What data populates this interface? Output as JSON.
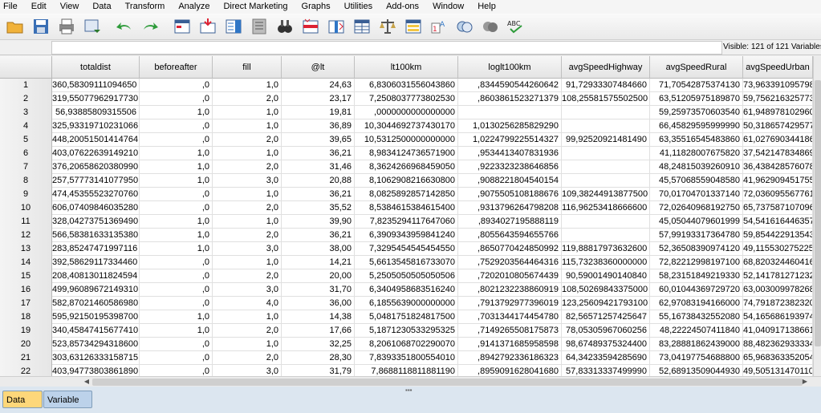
{
  "menu": [
    "File",
    "Edit",
    "View",
    "Data",
    "Transform",
    "Analyze",
    "Direct Marketing",
    "Graphs",
    "Utilities",
    "Add-ons",
    "Window",
    "Help"
  ],
  "toolbar": {
    "icons": [
      "open-folder-icon",
      "save-icon",
      "print-icon",
      "recall-dialog-icon",
      "undo-icon",
      "redo-icon",
      "goto-case-icon",
      "goto-variable-icon",
      "variables-icon",
      "run-descriptives-icon",
      "find-icon",
      "insert-cases-icon",
      "insert-variable-icon",
      "split-file-icon",
      "weight-cases-icon",
      "select-cases-icon",
      "value-labels-icon",
      "use-variable-sets-icon",
      "show-all-variables-icon",
      "spelling-icon"
    ]
  },
  "status": {
    "visible": "Visible: 121 of 121 Variables"
  },
  "grid": {
    "columns": [
      "totaldist",
      "beforeafter",
      "fill",
      "@lt",
      "lt100km",
      "loglt100km",
      "avgSpeedHighway",
      "avgSpeedRural",
      "avgSpeedUrban"
    ],
    "rows": [
      [
        "1",
        "360,58309111094650",
        ",0",
        "1,0",
        "24,63",
        "6,8306031556043860",
        ",8344590544260642",
        "91,72933307484660",
        "71,70542875374130",
        "73,963391095798"
      ],
      [
        "2",
        "319,55077962917730",
        ",0",
        "2,0",
        "23,17",
        "7,2508037773802530",
        ",8603861523271379",
        "108,25581575502500",
        "63,51205975189870",
        "59,756216325773"
      ],
      [
        "3",
        "56,93885809315506",
        "1,0",
        "1,0",
        "19,81",
        ",0000000000000000",
        "",
        "",
        "59,25973570603540",
        "61,948978102960"
      ],
      [
        "4",
        "325,93319710231066",
        ",0",
        "1,0",
        "36,89",
        "10,3044692737430170",
        "1,0130256285829290",
        "",
        "66,45829595999990",
        "50,318657429577"
      ],
      [
        "5",
        "448,20051501414764",
        ",0",
        "2,0",
        "39,65",
        "10,5312500000000000",
        "1,0224799225514327",
        "99,92520921481490",
        "63,35516545483860",
        "61,027690344186"
      ],
      [
        "6",
        "403,07622639149210",
        "1,0",
        "1,0",
        "36,21",
        "8,9834124736571900",
        ",9534413407831936",
        "",
        "41,11828007675820",
        "37,542147834869"
      ],
      [
        "7",
        "376,20658620380990",
        "1,0",
        "2,0",
        "31,46",
        "8,3624266968459050",
        ",9223323238646856",
        "",
        "48,24815039260910",
        "36,438428576078"
      ],
      [
        "8",
        "257,57773141077950",
        "1,0",
        "3,0",
        "20,88",
        "8,1062908216630800",
        ",9088221804540154",
        "",
        "45,57068559048580",
        "41,962909451755"
      ],
      [
        "9",
        "474,45355523270760",
        ",0",
        "1,0",
        "36,21",
        "8,0825892857142850",
        ",9075505108188676",
        "109,38244913877500",
        "70,01704701337140",
        "72,036095567761"
      ],
      [
        "10",
        "606,07409846035280",
        ",0",
        "2,0",
        "35,52",
        "8,5384615384615400",
        ",9313796264798208",
        "116,96253418666600",
        "72,02640968192750",
        "65,737587107096"
      ],
      [
        "11",
        "328,04273751369490",
        "1,0",
        "1,0",
        "39,90",
        "7,8235294117647060",
        ",8934027195888119",
        "",
        "45,05044079601999",
        "54,541616446357"
      ],
      [
        "12",
        "566,58381633135380",
        "1,0",
        "2,0",
        "36,21",
        "6,3909343959841240",
        ",8055643594655766",
        "",
        "57,99193317364780",
        "59,854422913543"
      ],
      [
        "13",
        "283,85247471997116",
        "1,0",
        "3,0",
        "38,00",
        "7,3295454545454550",
        ",8650770424850992",
        "119,88817973632600",
        "52,36508390974120",
        "49,115530275225"
      ],
      [
        "14",
        "392,58629117334460",
        ",0",
        "1,0",
        "14,21",
        "5,6613545816733070",
        ",7529203564464316",
        "115,73238360000000",
        "72,82212998197100",
        "68,820324460416"
      ],
      [
        "15",
        "208,40813011824594",
        ",0",
        "2,0",
        "20,00",
        "5,2505050505050506",
        ",7202010805674439",
        "90,59001490140840",
        "58,23151849219330",
        "52,141781271232"
      ],
      [
        "16",
        "499,96089672149310",
        ",0",
        "3,0",
        "31,70",
        "6,3404958683516240",
        ",8021232238860919",
        "108,50269843375000",
        "60,01044369729720",
        "63,003009978268"
      ],
      [
        "17",
        "582,87021460586980",
        ",0",
        "4,0",
        "36,00",
        "6,1855639000000000",
        ",7913792977396019",
        "123,25609421793100",
        "62,97083194166000",
        "74,791872382320"
      ],
      [
        "18",
        "595,92150195398700",
        "1,0",
        "1,0",
        "14,38",
        "5,0481751824817500",
        ",7031344174454780",
        "82,56571257425647",
        "55,16738432552080",
        "54,165686193974"
      ],
      [
        "19",
        "340,45847415677410",
        "1,0",
        "2,0",
        "17,66",
        "5,1871230533295325",
        ",7149265508175873",
        "78,05305967060256",
        "48,22224507411840",
        "41,040917138661"
      ],
      [
        "20",
        "523,85734294318600",
        ",0",
        "1,0",
        "32,25",
        "8,2061068702290070",
        ",9141371685958598",
        "98,67489375324400",
        "83,28881862439000",
        "88,482362933334"
      ],
      [
        "21",
        "303,63126333158715",
        ",0",
        "2,0",
        "28,30",
        "7,8393351800554010",
        ",8942792336186323",
        "64,34233594285690",
        "73,04197754688800",
        "65,968363352054"
      ],
      [
        "22",
        "403,94773803861890",
        ",0",
        "3,0",
        "31,79",
        "7,8688118811881190",
        ",8959091628041680",
        "57,83313337499990",
        "52,68913509044930",
        "49,505131470110"
      ]
    ]
  },
  "tabs": {
    "data_view": "Data View",
    "variable_view": "Variable View"
  }
}
